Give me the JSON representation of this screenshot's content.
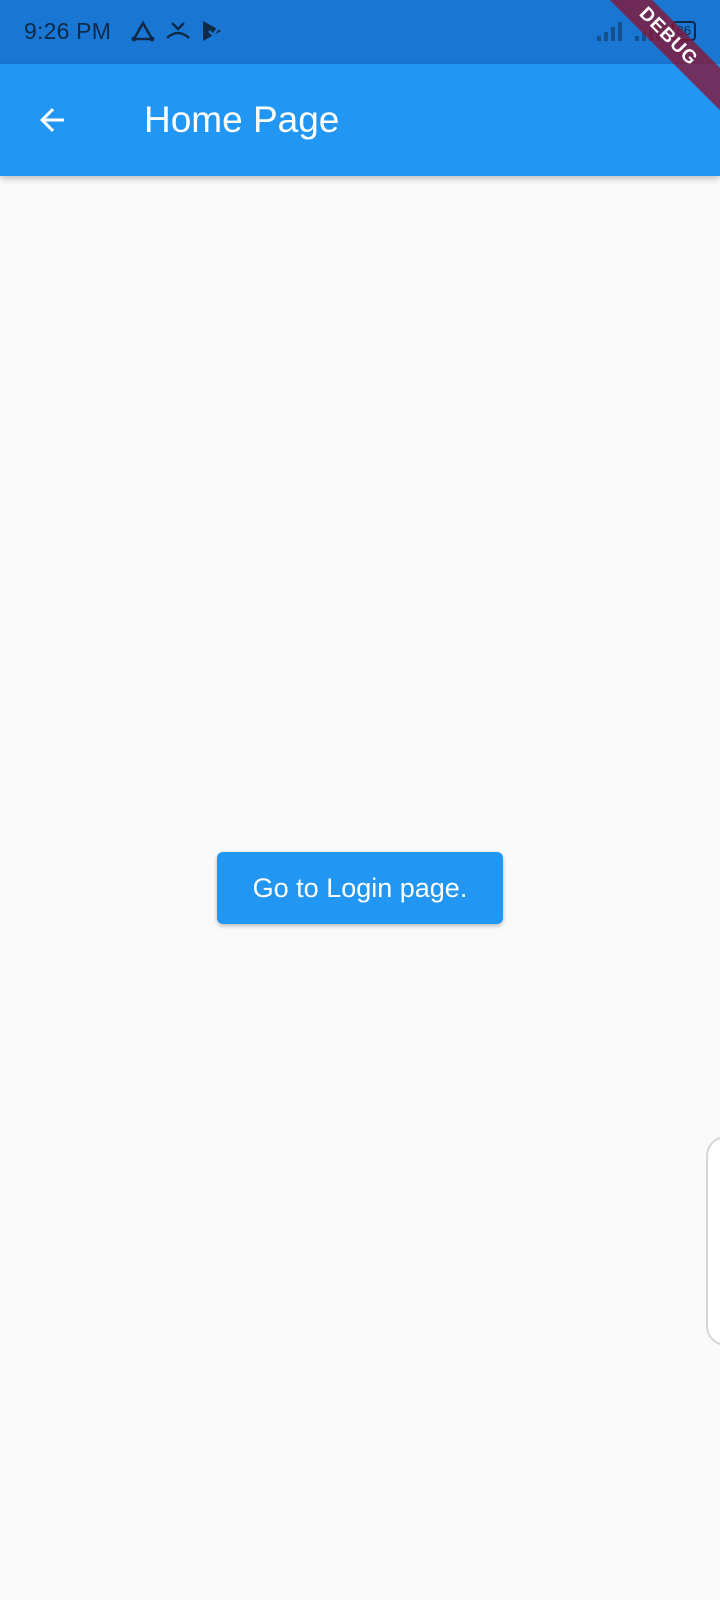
{
  "status_bar": {
    "time": "9:26 PM",
    "left_icons": [
      "transfer-icon",
      "missed-call-icon",
      "play-store-icon"
    ],
    "battery": "86",
    "bg_color": "#1976d2"
  },
  "app_bar": {
    "title": "Home Page",
    "back_icon": "arrow-back-icon",
    "bg_color": "#2196f3"
  },
  "debug_banner": {
    "label": "DEBUG",
    "color": "#881436"
  },
  "main": {
    "login_button_label": "Go to Login page.",
    "button_color": "#2196f3"
  }
}
